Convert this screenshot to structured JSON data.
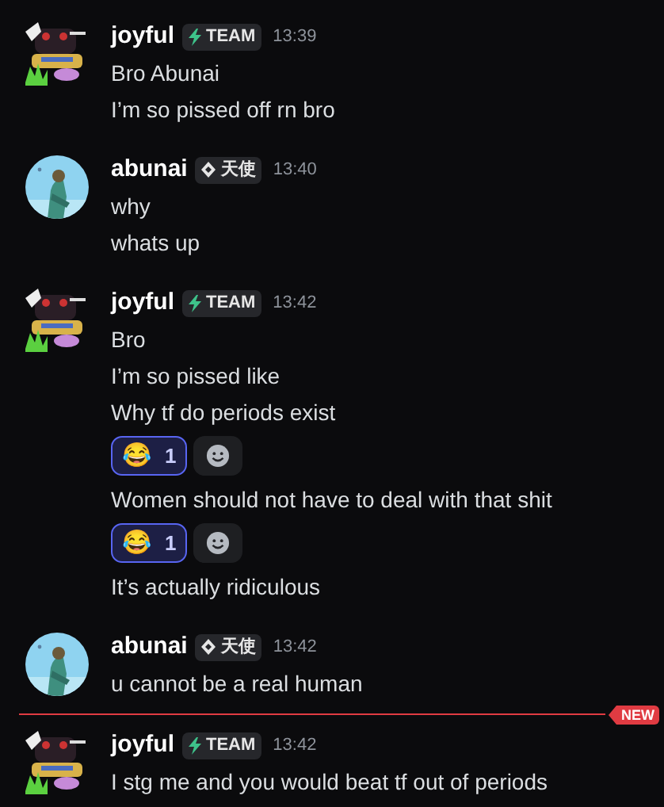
{
  "groups": [
    {
      "avatar": {
        "kind": "square"
      },
      "author": "joyful",
      "tag": {
        "kind": "bolt",
        "label": "TEAM"
      },
      "time": "13:39",
      "new_before": false,
      "messages": [
        {
          "text": "Bro Abunai"
        },
        {
          "text": "I’m so pissed off rn bro"
        }
      ]
    },
    {
      "avatar": {
        "kind": "circle"
      },
      "author": "abunai",
      "tag": {
        "kind": "diamond",
        "label": "天使"
      },
      "time": "13:40",
      "new_before": false,
      "messages": [
        {
          "text": "why"
        },
        {
          "text": "whats up"
        }
      ]
    },
    {
      "avatar": {
        "kind": "square"
      },
      "author": "joyful",
      "tag": {
        "kind": "bolt",
        "label": "TEAM"
      },
      "time": "13:42",
      "new_before": false,
      "messages": [
        {
          "text": "Bro"
        },
        {
          "text": "I’m so pissed like"
        },
        {
          "text": "Why tf do periods exist",
          "reactions": [
            {
              "emoji": "😂",
              "count": "1",
              "selected": true
            }
          ]
        },
        {
          "text": "Women should not have to deal with that shit",
          "reactions": [
            {
              "emoji": "😂",
              "count": "1",
              "selected": true
            }
          ]
        },
        {
          "text": "It’s actually ridiculous"
        }
      ]
    },
    {
      "avatar": {
        "kind": "circle"
      },
      "author": "abunai",
      "tag": {
        "kind": "diamond",
        "label": "天使"
      },
      "time": "13:42",
      "new_before": false,
      "messages": [
        {
          "text": "u cannot be a real human"
        }
      ]
    },
    {
      "avatar": {
        "kind": "square"
      },
      "author": "joyful",
      "tag": {
        "kind": "bolt",
        "label": "TEAM"
      },
      "time": "13:42",
      "new_before": true,
      "new_label": "NEW",
      "messages": [
        {
          "text": "I stg me and you would beat tf out of periods"
        }
      ]
    }
  ]
}
